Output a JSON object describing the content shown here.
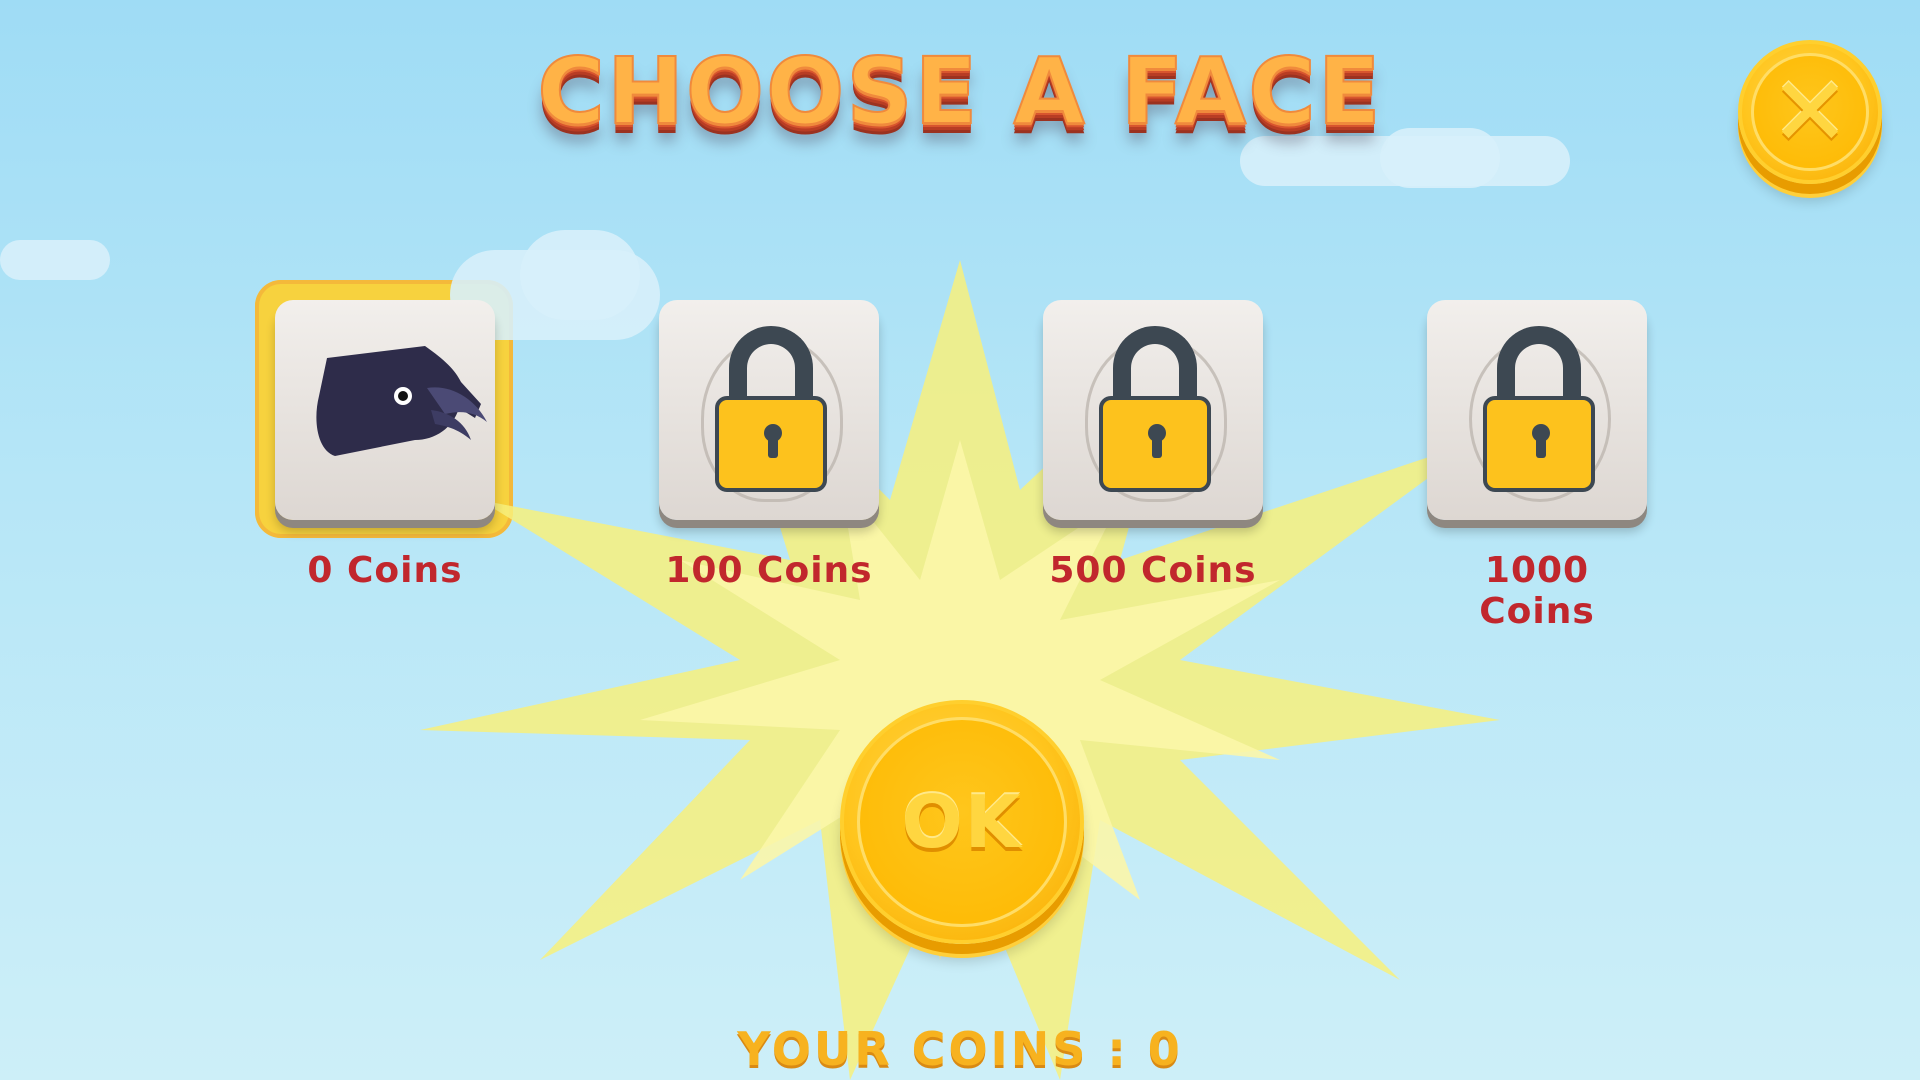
{
  "title": "CHOOSE A FACE",
  "close_button": {
    "icon": "close-x-icon",
    "glyph": "✕"
  },
  "faces": [
    {
      "price": "0 Coins",
      "locked": false,
      "selected": true,
      "icon": "raven-face-icon"
    },
    {
      "price": "100 Coins",
      "locked": true,
      "selected": false,
      "icon": "padlock-icon"
    },
    {
      "price": "500 Coins",
      "locked": true,
      "selected": false,
      "icon": "padlock-icon"
    },
    {
      "price": "1000 Coins",
      "locked": true,
      "selected": false,
      "icon": "padlock-icon"
    }
  ],
  "ok_button": {
    "label": "OK"
  },
  "your_coins": "YOUR COINS : 0",
  "colors": {
    "price": "#c1272d",
    "coin": "#ffc51d",
    "title": "#ffb347",
    "lock": "#fdc21d"
  }
}
